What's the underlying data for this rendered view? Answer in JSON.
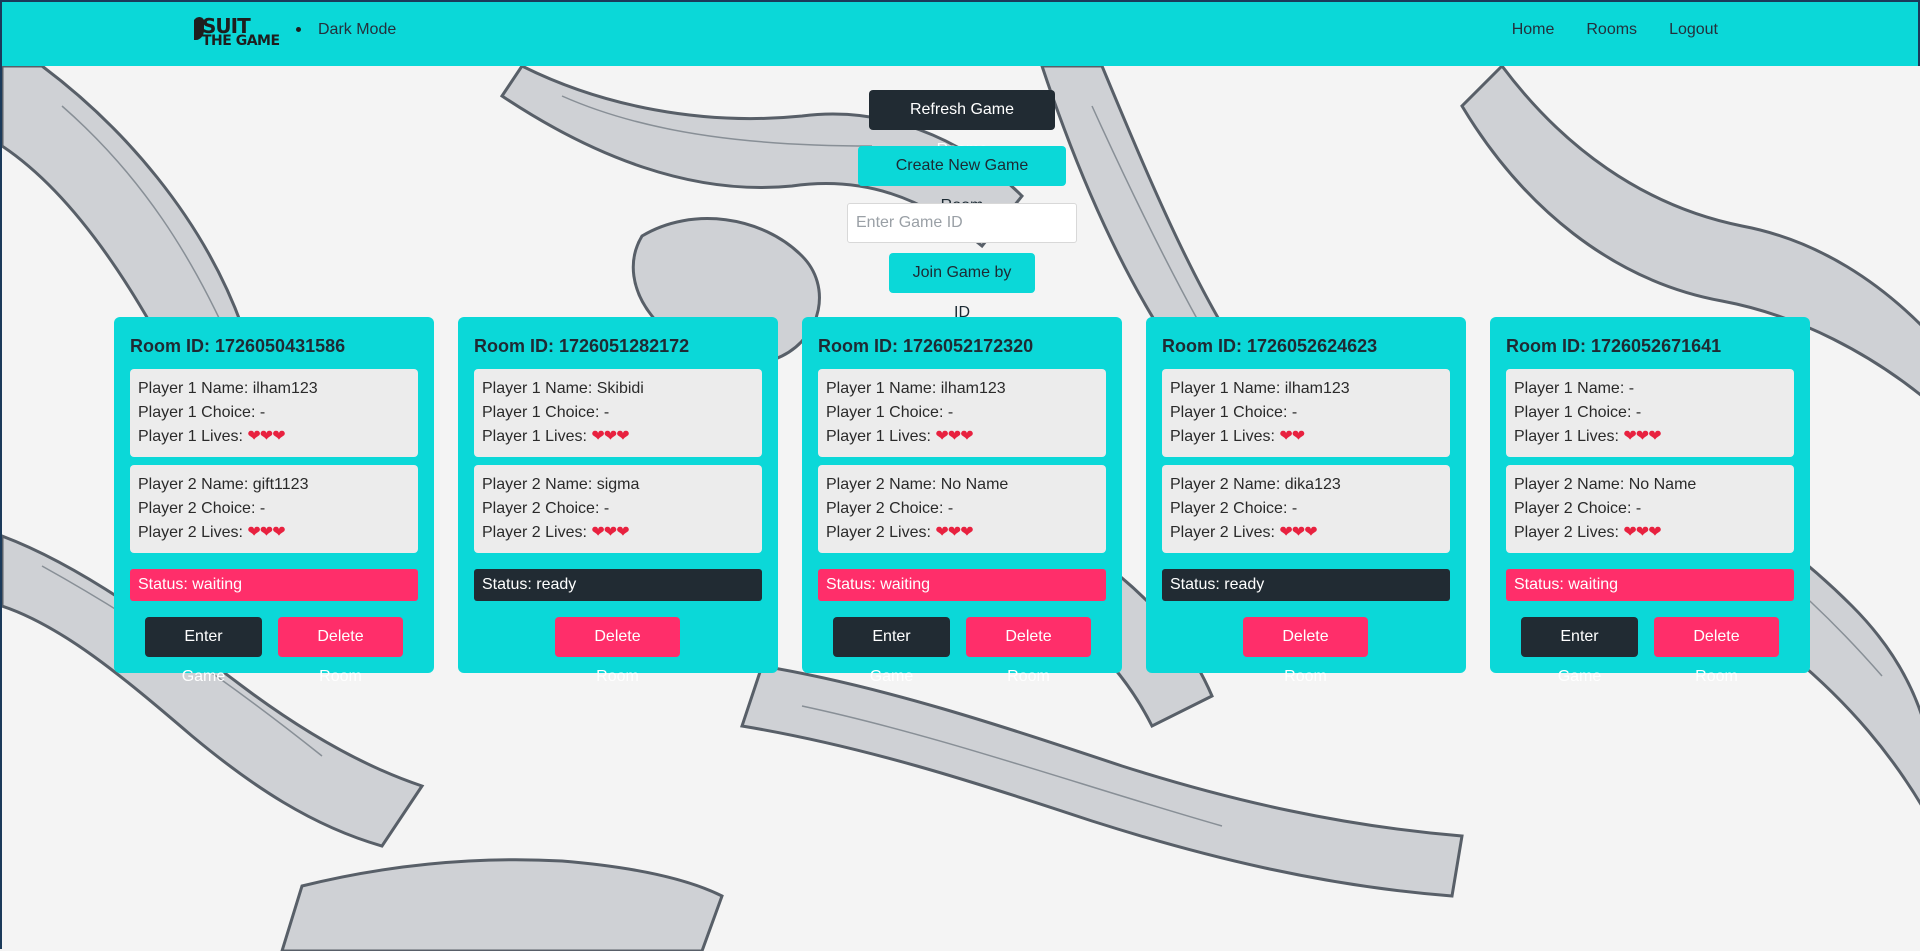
{
  "brand": {
    "line1": "SUIT",
    "line2": "THE GAME"
  },
  "navbar": {
    "dark_mode": "Dark Mode",
    "links": [
      "Home",
      "Rooms",
      "Logout"
    ]
  },
  "controls": {
    "refresh_label": "Refresh Game Rooms",
    "create_label": "Create New Game Room",
    "game_id_placeholder": "Enter Game ID",
    "join_label": "Join Game by ID"
  },
  "colors": {
    "accent": "#0bd8d8",
    "dark": "#212b33",
    "pink": "#ff2e6a",
    "heart": "#e8213f"
  },
  "rooms": [
    {
      "title": "Room ID: 1726050431586",
      "p1_name": "Player 1 Name: ilham123",
      "p1_choice": "Player 1 Choice: -",
      "p1_lives_label": "Player 1 Lives:",
      "p1_hearts": "❤❤❤",
      "p2_name": "Player 2 Name: gift1123",
      "p2_choice": "Player 2 Choice: -",
      "p2_lives_label": "Player 2 Lives:",
      "p2_hearts": "❤❤❤",
      "status": "Status: waiting",
      "enter": "Enter Game",
      "delete": "Delete Room"
    },
    {
      "title": "Room ID: 1726051282172",
      "p1_name": "Player 1 Name: Skibidi",
      "p1_choice": "Player 1 Choice: -",
      "p1_lives_label": "Player 1 Lives:",
      "p1_hearts": "❤❤❤",
      "p2_name": "Player 2 Name: sigma",
      "p2_choice": "Player 2 Choice: -",
      "p2_lives_label": "Player 2 Lives:",
      "p2_hearts": "❤❤❤",
      "status": "Status: ready",
      "delete": "Delete Room"
    },
    {
      "title": "Room ID: 1726052172320",
      "p1_name": "Player 1 Name: ilham123",
      "p1_choice": "Player 1 Choice: -",
      "p1_lives_label": "Player 1 Lives:",
      "p1_hearts": "❤❤❤",
      "p2_name": "Player 2 Name: No Name",
      "p2_choice": "Player 2 Choice: -",
      "p2_lives_label": "Player 2 Lives:",
      "p2_hearts": "❤❤❤",
      "status": "Status: waiting",
      "enter": "Enter Game",
      "delete": "Delete Room"
    },
    {
      "title": "Room ID: 1726052624623",
      "p1_name": "Player 1 Name: ilham123",
      "p1_choice": "Player 1 Choice: -",
      "p1_lives_label": "Player 1 Lives:",
      "p1_hearts": "❤❤",
      "p2_name": "Player 2 Name: dika123",
      "p2_choice": "Player 2 Choice: -",
      "p2_lives_label": "Player 2 Lives:",
      "p2_hearts": "❤❤❤",
      "status": "Status: ready",
      "delete": "Delete Room"
    },
    {
      "title": "Room ID: 1726052671641",
      "p1_name": "Player 1 Name: -",
      "p1_choice": "Player 1 Choice: -",
      "p1_lives_label": "Player 1 Lives:",
      "p1_hearts": "❤❤❤",
      "p2_name": "Player 2 Name: No Name",
      "p2_choice": "Player 2 Choice: -",
      "p2_lives_label": "Player 2 Lives:",
      "p2_hearts": "❤❤❤",
      "status": "Status: waiting",
      "enter": "Enter Game",
      "delete": "Delete Room"
    }
  ]
}
